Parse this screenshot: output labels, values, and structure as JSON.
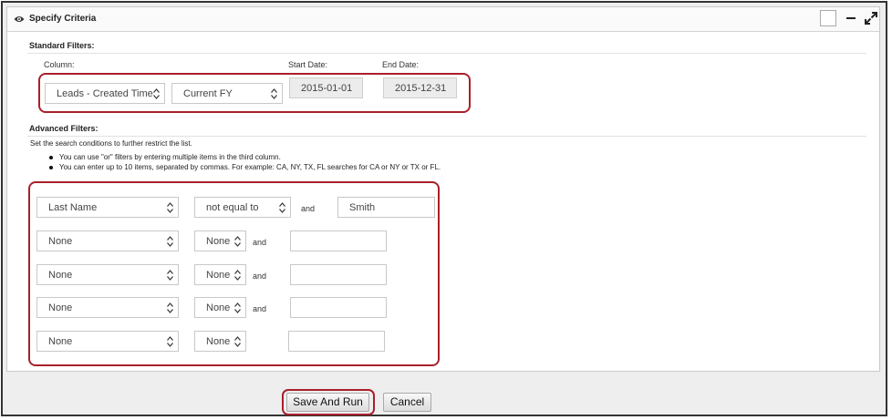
{
  "panel": {
    "title": "Specify Criteria"
  },
  "standard": {
    "heading": "Standard Filters:",
    "column_label": "Column:",
    "start_label": "Start Date:",
    "end_label": "End Date:",
    "column_value": "Leads - Created Time",
    "period_value": "Current FY",
    "start_date": "2015-01-01",
    "end_date": "2015-12-31"
  },
  "advanced": {
    "heading": "Advanced Filters:",
    "description": "Set the search conditions to further restrict the list.",
    "tips": [
      "You can use \"or\" filters by entering multiple items in the third column.",
      "You can enter up to 10 items, separated by commas. For example: CA, NY, TX, FL searches for CA or NY or TX or FL."
    ],
    "rows": [
      {
        "field": "Last Name",
        "operator": "not equal to",
        "conjunction": "and",
        "value": "Smith"
      },
      {
        "field": "None",
        "operator": "None",
        "conjunction": "and",
        "value": ""
      },
      {
        "field": "None",
        "operator": "None",
        "conjunction": "and",
        "value": ""
      },
      {
        "field": "None",
        "operator": "None",
        "conjunction": "and",
        "value": ""
      },
      {
        "field": "None",
        "operator": "None",
        "conjunction": "",
        "value": ""
      }
    ]
  },
  "buttons": {
    "save_and_run": "Save And Run",
    "cancel": "Cancel"
  },
  "colors": {
    "highlight": "#a8202a"
  }
}
